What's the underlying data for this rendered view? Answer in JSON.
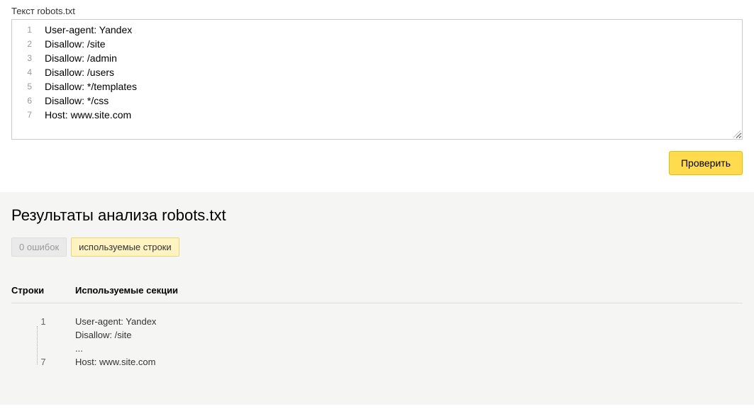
{
  "editor": {
    "label": "Текст robots.txt",
    "lines": [
      "User-agent: Yandex",
      "Disallow: /site",
      "Disallow: /admin",
      "Disallow: /users",
      "Disallow: */templates",
      "Disallow: */css",
      "Host: www.site.com"
    ]
  },
  "buttons": {
    "check": "Проверить"
  },
  "results": {
    "heading": "Результаты анализа robots.txt",
    "errors_badge": "0 ошибок",
    "used_lines_badge": "используемые строки",
    "columns": {
      "lines": "Строки",
      "sections": "Используемые секции"
    },
    "range": {
      "start": "1",
      "end": "7"
    },
    "section_lines": [
      "User-agent: Yandex",
      "Disallow: /site",
      "...",
      "Host: www.site.com"
    ]
  }
}
